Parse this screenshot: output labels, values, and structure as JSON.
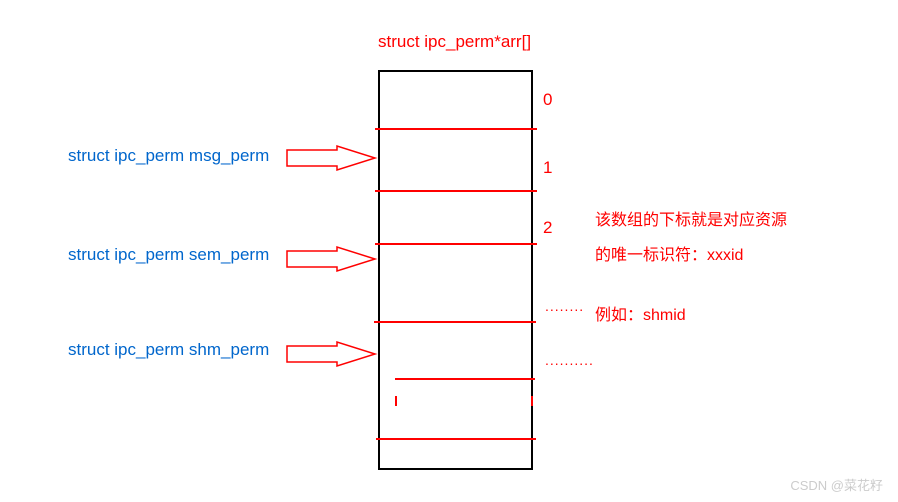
{
  "title": "struct ipc_perm*arr[]",
  "labels": {
    "msg_perm": "struct ipc_perm  msg_perm",
    "sem_perm": "struct ipc_perm  sem_perm",
    "shm_perm": "struct ipc_perm  shm_perm"
  },
  "indices": [
    "0",
    "1",
    "2"
  ],
  "dots1": "........",
  "dots2": "..........",
  "description": {
    "line1": "该数组的下标就是对应资源",
    "line2": "的唯一标识符：xxxid",
    "line3": "例如：shmid"
  },
  "watermark": "CSDN @菜花籽"
}
